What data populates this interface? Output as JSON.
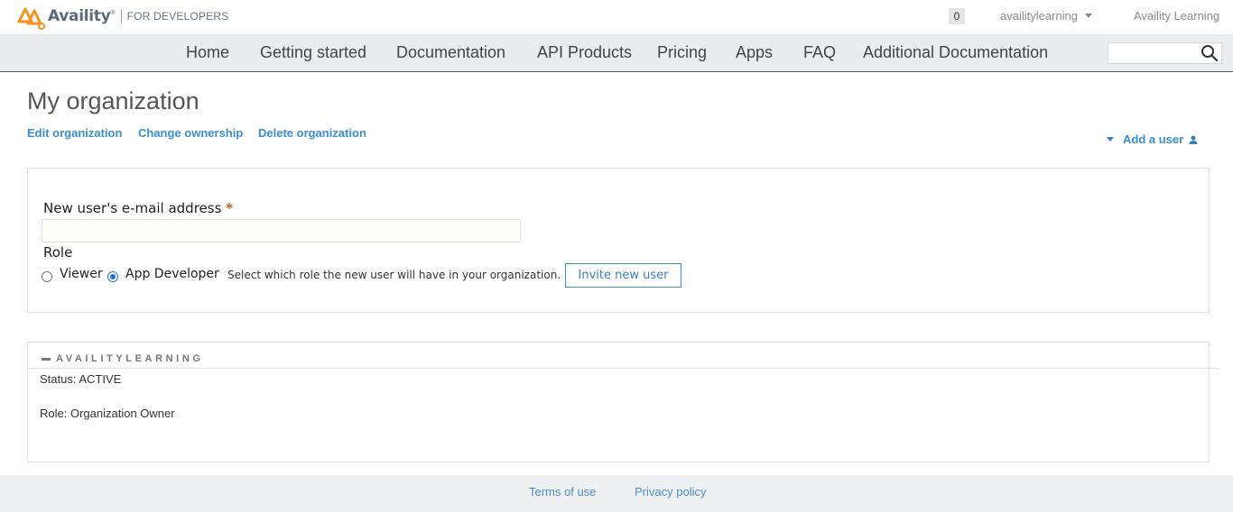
{
  "header": {
    "brand": "Availity",
    "brand_mark": "®",
    "subtitle": "FOR DEVELOPERS",
    "notification_count": "0",
    "username": "availitylearning",
    "org_name": "Availity Learning"
  },
  "nav": {
    "items": [
      "Home",
      "Getting started",
      "Documentation",
      "API Products",
      "Pricing",
      "Apps",
      "FAQ",
      "Additional Documentation"
    ],
    "search_placeholder": ""
  },
  "page": {
    "title": "My organization",
    "actions": [
      "Edit organization",
      "Change ownership",
      "Delete organization"
    ],
    "add_user_label": "Add a user"
  },
  "form": {
    "email_label": "New user's e-mail address",
    "required_marker": "*",
    "email_value": "",
    "role_label": "Role",
    "roles": [
      {
        "label": "Viewer",
        "checked": false
      },
      {
        "label": "App Developer",
        "checked": true
      }
    ],
    "role_help": "Select which role the new user will have in your organization.",
    "submit_label": "Invite new user"
  },
  "org_details": {
    "name": "AVAILITYLEARNING",
    "status": "Status: ACTIVE",
    "role": "Role: Organization Owner"
  },
  "footer": {
    "links": [
      "Terms of use",
      "Privacy policy"
    ]
  },
  "colors": {
    "link": "#3a8fd6",
    "nav_bg": "#eaecee",
    "footer_bg": "#eef0f1",
    "brand_orange": "#f7941d",
    "required": "#c26414"
  }
}
